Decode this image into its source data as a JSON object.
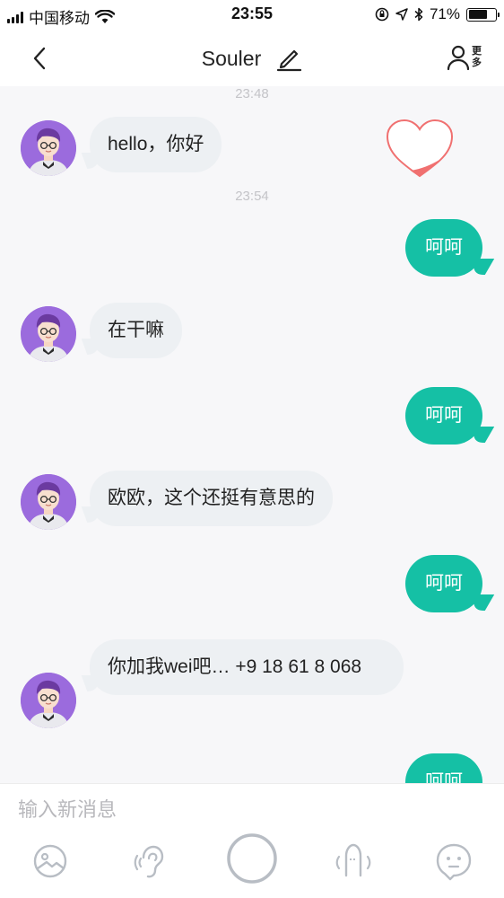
{
  "status_bar": {
    "carrier": "中国移动",
    "time": "23:55",
    "battery_percent": "71%",
    "battery_level": 0.71
  },
  "header": {
    "title": "Souler",
    "more_label": "更多"
  },
  "messages": [
    {
      "type": "timestamp",
      "text": "23:48"
    },
    {
      "type": "incoming",
      "text": "hello，你好"
    },
    {
      "type": "timestamp",
      "text": "23:54"
    },
    {
      "type": "outgoing",
      "text": "呵呵"
    },
    {
      "type": "incoming",
      "text": "在干嘛"
    },
    {
      "type": "outgoing",
      "text": "呵呵"
    },
    {
      "type": "incoming",
      "text": "欧欧，这个还挺有意思的"
    },
    {
      "type": "outgoing",
      "text": "呵呵"
    },
    {
      "type": "incoming",
      "text": "你加我wei吧…   +9   18   61 8 068"
    },
    {
      "type": "outgoing",
      "text": "呵呵"
    }
  ],
  "input": {
    "placeholder": "输入新消息",
    "value": ""
  },
  "toolbar": {
    "icons": [
      "image-icon",
      "ear-icon",
      "record-icon",
      "microphone-icon",
      "emoji-icon"
    ]
  },
  "colors": {
    "accent": "#15c0a5",
    "incoming_bubble": "#edf0f3",
    "heart": "#f07070",
    "icon_gray": "#b8bdc4"
  }
}
